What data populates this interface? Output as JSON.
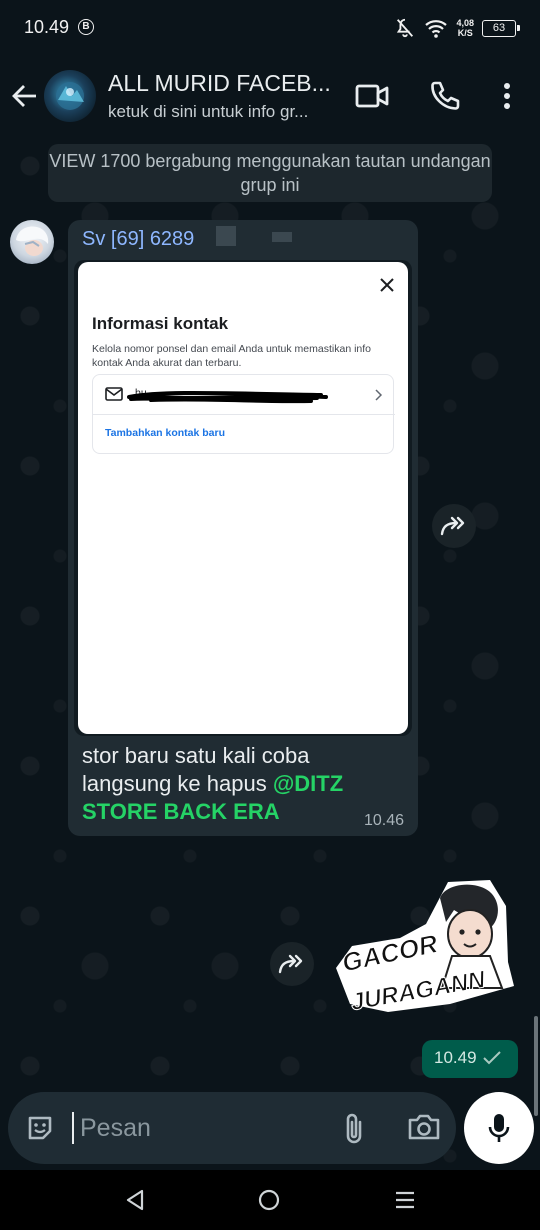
{
  "status_bar": {
    "time": "10.49",
    "b_badge": "B",
    "net_speed_value": "4,08",
    "net_speed_unit": "K/S",
    "battery": "63"
  },
  "header": {
    "title": "ALL MURID FACEB...",
    "subtitle": "ketuk di sini untuk info gr..."
  },
  "system_message": "VIEW 1700 bergabung menggunakan tautan undangan grup ini",
  "incoming_message": {
    "sender": "Sv [69] 6289",
    "screenshot": {
      "title": "Informasi kontak",
      "description": "Kelola nomor ponsel dan email Anda untuk memastikan info kontak Anda akurat dan terbaru.",
      "email_partial": "bu",
      "add_contact_link": "Tambahkan kontak baru"
    },
    "text": "stor baru satu kali coba langsung ke hapus ",
    "mention": "@DITZ STORE BACK ERA",
    "time": "10.46"
  },
  "sticker": {
    "line1": "GACOR",
    "line2": "JURAGANN"
  },
  "outgoing_message": {
    "time": "10.49"
  },
  "composer": {
    "placeholder": "Pesan"
  },
  "colors": {
    "background": "#0b141a",
    "incoming_bubble": "#202c33",
    "outgoing_bubble": "#005c4b",
    "mention": "#25d366",
    "sender_name": "#8eb7ff",
    "link": "#1b74e4"
  },
  "icons": [
    "back-arrow-icon",
    "video-call-icon",
    "phone-icon",
    "more-vert-icon",
    "forward-icon",
    "double-check-icon",
    "emoji-icon",
    "attach-icon",
    "camera-icon",
    "mic-icon",
    "nav-back-icon",
    "nav-home-icon",
    "nav-recents-icon",
    "mute-icon",
    "wifi-icon",
    "battery-icon"
  ]
}
